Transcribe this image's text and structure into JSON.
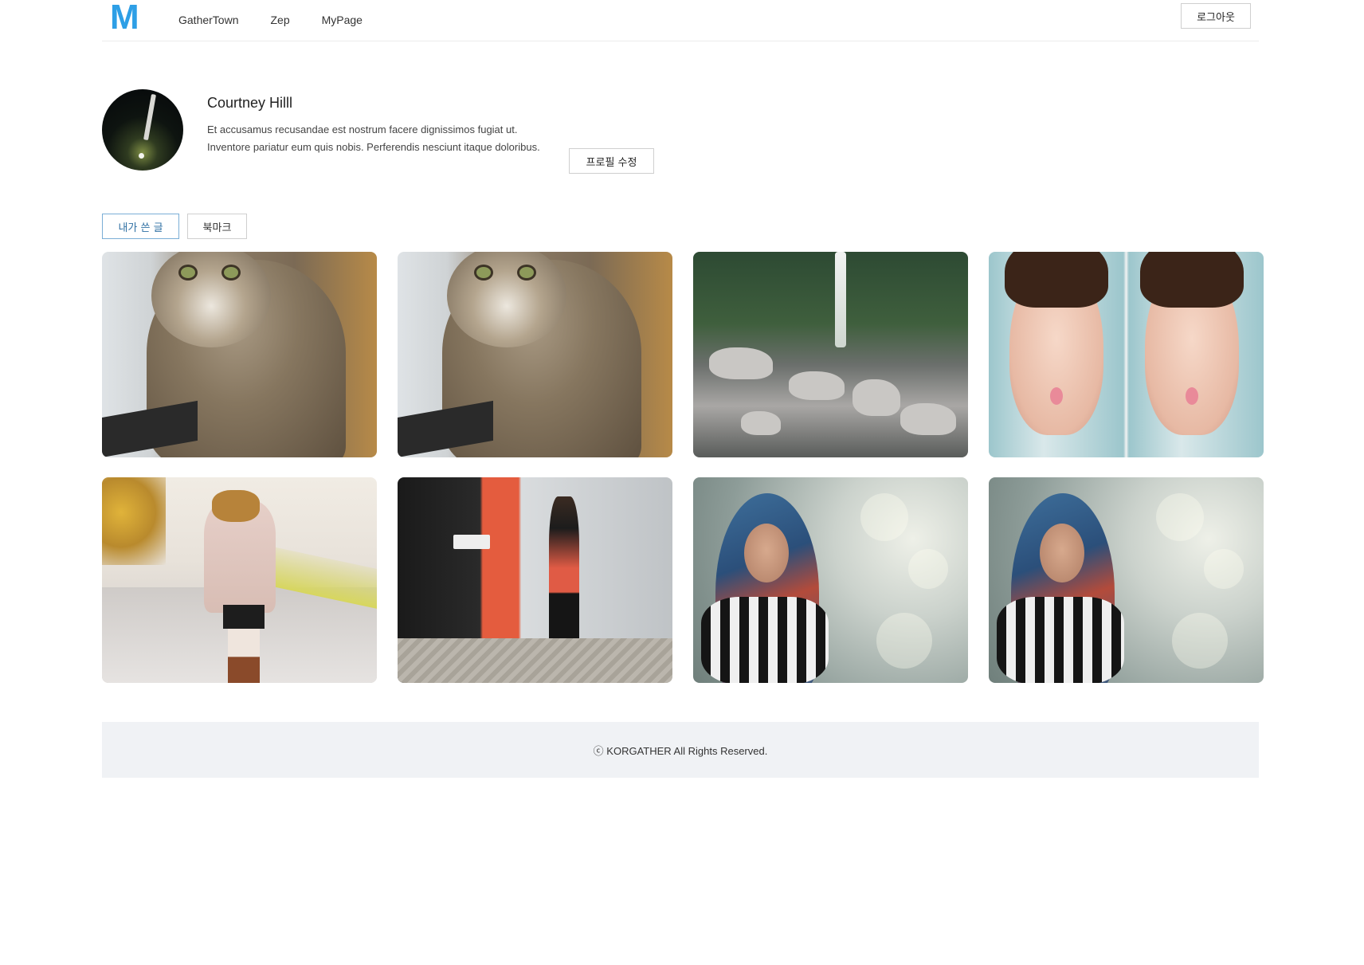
{
  "header": {
    "logo": "M",
    "nav": [
      "GatherTown",
      "Zep",
      "MyPage"
    ],
    "logout_label": "로그아웃"
  },
  "profile": {
    "name": "Courtney Hilll",
    "bio": "Et accusamus recusandae est nostrum facere dignissimos fugiat ut. Inventore pariatur eum quis nobis. Perferendis nesciunt itaque doloribus.",
    "edit_label": "프로필 수정"
  },
  "tabs": {
    "my_posts": "내가 쓴 글",
    "bookmarks": "북마크"
  },
  "posts": [
    {
      "image": "tabby-cat"
    },
    {
      "image": "tabby-cat"
    },
    {
      "image": "waterfall-rocks"
    },
    {
      "image": "woman-funny-face-diptych"
    },
    {
      "image": "woman-autumn-road"
    },
    {
      "image": "woman-street-dog"
    },
    {
      "image": "woman-blue-scarf-hood"
    },
    {
      "image": "woman-blue-scarf-hood"
    }
  ],
  "footer": {
    "text": "ⓒ KORGATHER All Rights Reserved."
  },
  "colors": {
    "logo": "#2e9fe6",
    "active_tab_border": "#7aaed6",
    "footer_bg": "#f0f2f5"
  }
}
